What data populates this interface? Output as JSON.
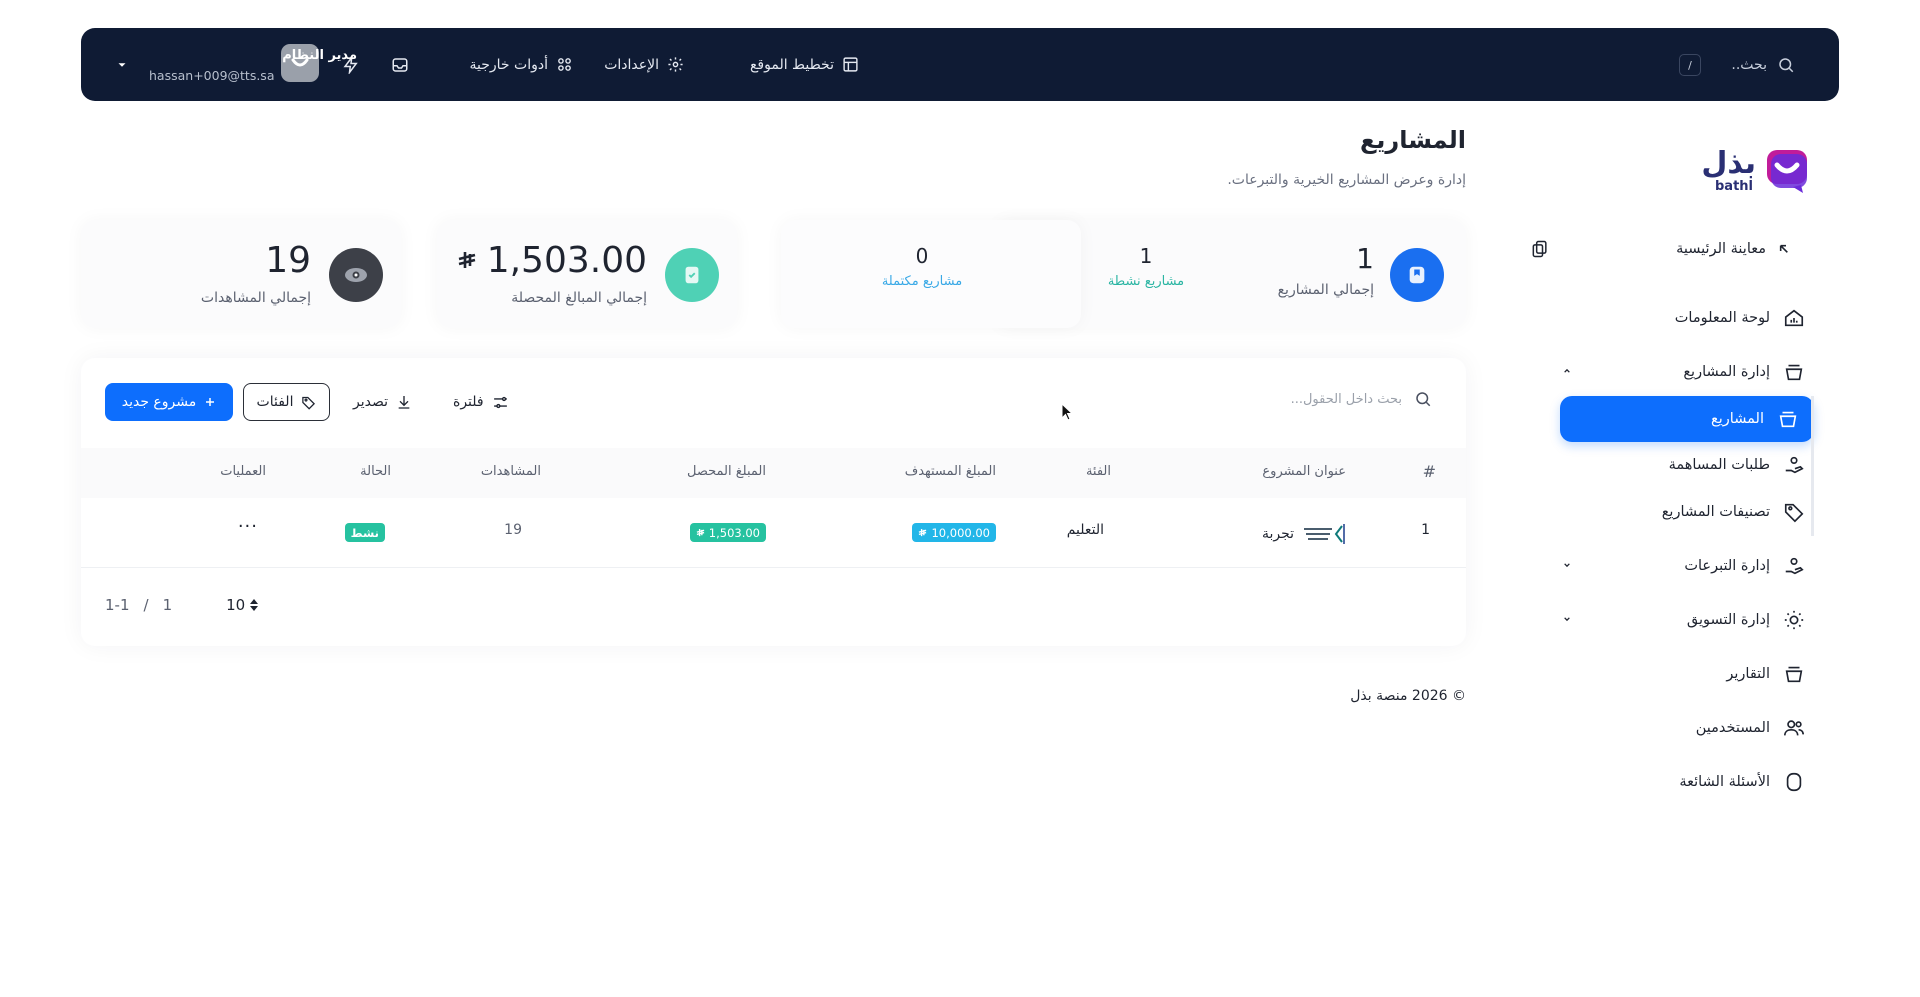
{
  "topbar": {
    "search_label": "بحث..",
    "search_shortcut": "/",
    "nav_site_layout": "تخطيط الموقع",
    "nav_settings": "الإعدادات",
    "nav_external_tools": "أدوات خارجية",
    "user_name": "مدير النظام",
    "user_email": "hassan+009@tts.sa",
    "bg_color": "#0f1b34"
  },
  "logo": {
    "text": "بذل",
    "sub": "bathl"
  },
  "sidebar": {
    "preview": "معاينة الرئيسية",
    "dashboard": "لوحة المعلومات",
    "projects_management": "إدارة المشاريع",
    "projects": "المشاريع",
    "contribution_requests": "طلبات المساهمة",
    "project_categories": "تصنيفات المشاريع",
    "donations_management": "إدارة التبرعات",
    "marketing_management": "إدارة التسويق",
    "reports": "التقارير",
    "users": "المستخدمين",
    "faq": "الأسئلة الشائعة",
    "accent_color": "#0d6efd"
  },
  "page": {
    "title": "المشاريع",
    "subtitle": "إدارة وعرض المشاريع الخيرية والتبرعات."
  },
  "stats": {
    "total_projects_value": "1",
    "total_projects_label": "إجمالي المشاريع",
    "active_projects_value": "1",
    "active_projects_label": "مشاريع نشطة",
    "completed_projects_value": "0",
    "completed_projects_label": "مشاريع مكتملة",
    "collected_value": "1,503.00",
    "collected_label": "إجمالي المبالغ المحصلة",
    "views_value": "19",
    "views_label": "إجمالي المشاهدات"
  },
  "toolbar": {
    "search_placeholder": "بحث داخل الحقول...",
    "filter": "فلترة",
    "export": "تصدير",
    "categories": "الفئات",
    "new_project": "مشروع جديد"
  },
  "table": {
    "headers": {
      "index": "#",
      "title": "عنوان المشروع",
      "category": "الفئة",
      "target": "المبلغ المستهدف",
      "collected": "المبلغ المحصل",
      "views": "المشاهدات",
      "status": "الحالة",
      "actions": "العمليات"
    },
    "rows": [
      {
        "index": "1",
        "title": "تجربة",
        "category": "التعليم",
        "target": "10,000.00",
        "collected": "1,503.00",
        "views": "19",
        "status": "نشط",
        "actions": "···"
      }
    ]
  },
  "pagination": {
    "page_size": "10",
    "page": "1",
    "separator": "/",
    "range": "1-1"
  },
  "footer": {
    "text": "© 2026 منصة بذل"
  }
}
